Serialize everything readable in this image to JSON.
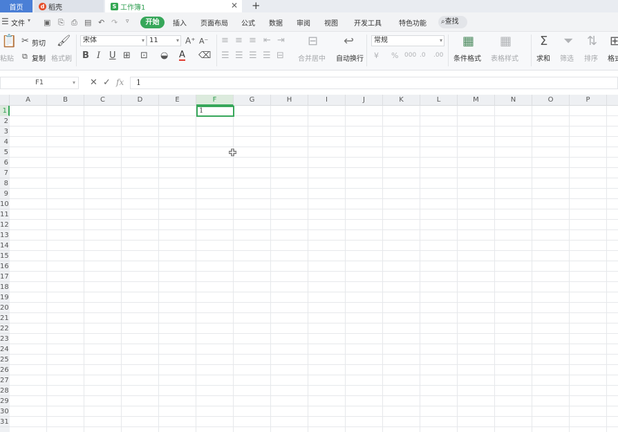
{
  "tabs": {
    "home": "首页",
    "daoke": "稻壳",
    "workbook": "工作簿1",
    "add": "+"
  },
  "menu": {
    "file": "文件",
    "start": "开始",
    "insert": "插入",
    "page_layout": "页面布局",
    "formula": "公式",
    "data": "数据",
    "review": "审阅",
    "view": "视图",
    "developer": "开发工具",
    "special": "特色功能",
    "search": "查找"
  },
  "ribbon": {
    "paste": "粘贴",
    "cut": "剪切",
    "copy": "复制",
    "format_painter": "格式刷",
    "font_name": "宋体",
    "font_size": "11",
    "merge_center": "合并居中",
    "wrap_text": "自动换行",
    "number_format": "常规",
    "conditional_format": "条件格式",
    "table_style": "表格样式",
    "sum": "求和",
    "filter": "筛选",
    "sort": "排序",
    "format": "格式"
  },
  "formula_bar": {
    "name_box": "F1",
    "content": "1",
    "fx": "fx"
  },
  "sheet": {
    "columns": [
      "A",
      "B",
      "C",
      "D",
      "E",
      "F",
      "G",
      "H",
      "I",
      "J",
      "K",
      "L",
      "M",
      "N",
      "O",
      "P"
    ],
    "active_column": "F",
    "rows": [
      "1",
      "2",
      "3",
      "4",
      "5",
      "6",
      "7",
      "8",
      "9",
      "10",
      "11",
      "12",
      "13",
      "14",
      "15",
      "16",
      "17",
      "18",
      "19",
      "20",
      "21",
      "22",
      "23",
      "24",
      "25",
      "26",
      "27",
      "28",
      "29",
      "30",
      "31"
    ],
    "active_row": "1",
    "cell_f1": "1"
  },
  "colors": {
    "accent": "#37a75a",
    "home_tab": "#4a7fd6"
  }
}
